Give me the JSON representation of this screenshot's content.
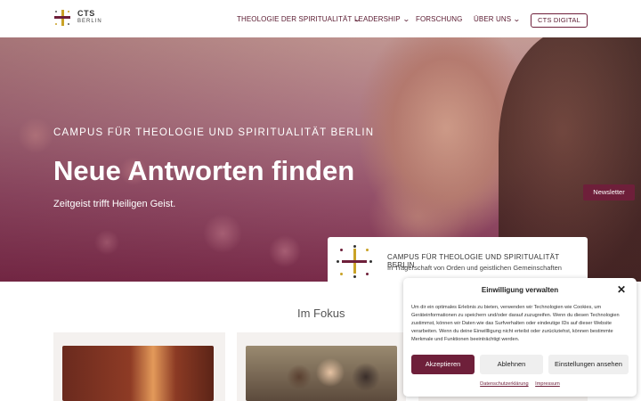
{
  "header": {
    "logo": {
      "title": "CTS",
      "subtitle": "BERLIN"
    },
    "nav": [
      {
        "label": "THEOLOGIE DER SPIRITUALITÄT",
        "has_dropdown": true
      },
      {
        "label": "LEADERSHIP",
        "has_dropdown": true
      },
      {
        "label": "FORSCHUNG",
        "has_dropdown": false
      },
      {
        "label": "ÜBER UNS",
        "has_dropdown": true
      }
    ],
    "cta": "CTS DIGITAL"
  },
  "hero": {
    "eyebrow": "CAMPUS FÜR THEOLOGIE UND SPIRITUALITÄT BERLIN",
    "headline": "Neue Antworten finden",
    "tagline": "Zeitgeist trifft Heiligen Geist.",
    "newsletter": "Newsletter",
    "campus_card": {
      "title": "CAMPUS FÜR THEOLOGIE UND SPIRITUALITÄT BERLIN",
      "subtitle": "In Trägerschaft von Orden und geistlichen Gemeinschaften"
    }
  },
  "main": {
    "section_title": "Im Fokus"
  },
  "consent": {
    "title": "Einwilligung verwalten",
    "body": "Um dir ein optimales Erlebnis zu bieten, verwenden wir Technologien wie Cookies, um Geräteinformationen zu speichern und/oder darauf zuzugreifen. Wenn du diesen Technologien zustimmst, können wir Daten wie das Surfverhalten oder eindeutige IDs auf dieser Website verarbeiten. Wenn du deine Einwillligung nicht erteilst oder zurückziehst, können bestimmte Merkmale und Funktionen beeinträchtigt werden.",
    "accept": "Akzeptieren",
    "decline": "Ablehnen",
    "settings": "Einstellungen ansehen",
    "links": [
      "Datenschutzerklärung",
      "Impressum"
    ]
  },
  "colors": {
    "brand": "#6e1f3a",
    "gold": "#c9a227",
    "button_gray": "#efefef"
  }
}
